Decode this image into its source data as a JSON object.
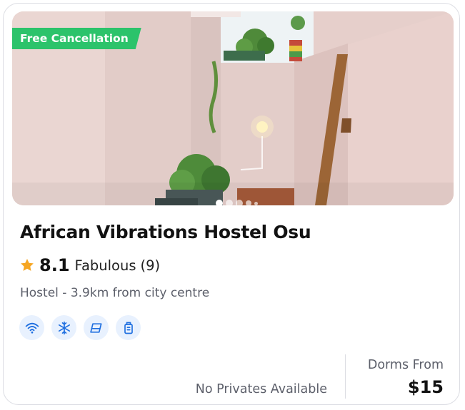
{
  "listing": {
    "badge": "Free Cancellation",
    "title": "African Vibrations Hostel Osu",
    "rating": {
      "score": "8.1",
      "label": "Fabulous",
      "count": "(9)"
    },
    "meta": "Hostel - 3.9km from city centre",
    "amenities": [
      "wifi-icon",
      "snowflake-icon",
      "linen-icon",
      "locker-icon"
    ],
    "carousel": {
      "current_index": 1,
      "visible_dots": 5
    },
    "availability": "No Privates Available",
    "price_label": "Dorms From",
    "price": "$15"
  },
  "colors": {
    "badge_bg": "#2cc36b",
    "star": "#f6a623",
    "icon_blue": "#1f6fe0",
    "icon_bg": "#e8f1fe"
  }
}
